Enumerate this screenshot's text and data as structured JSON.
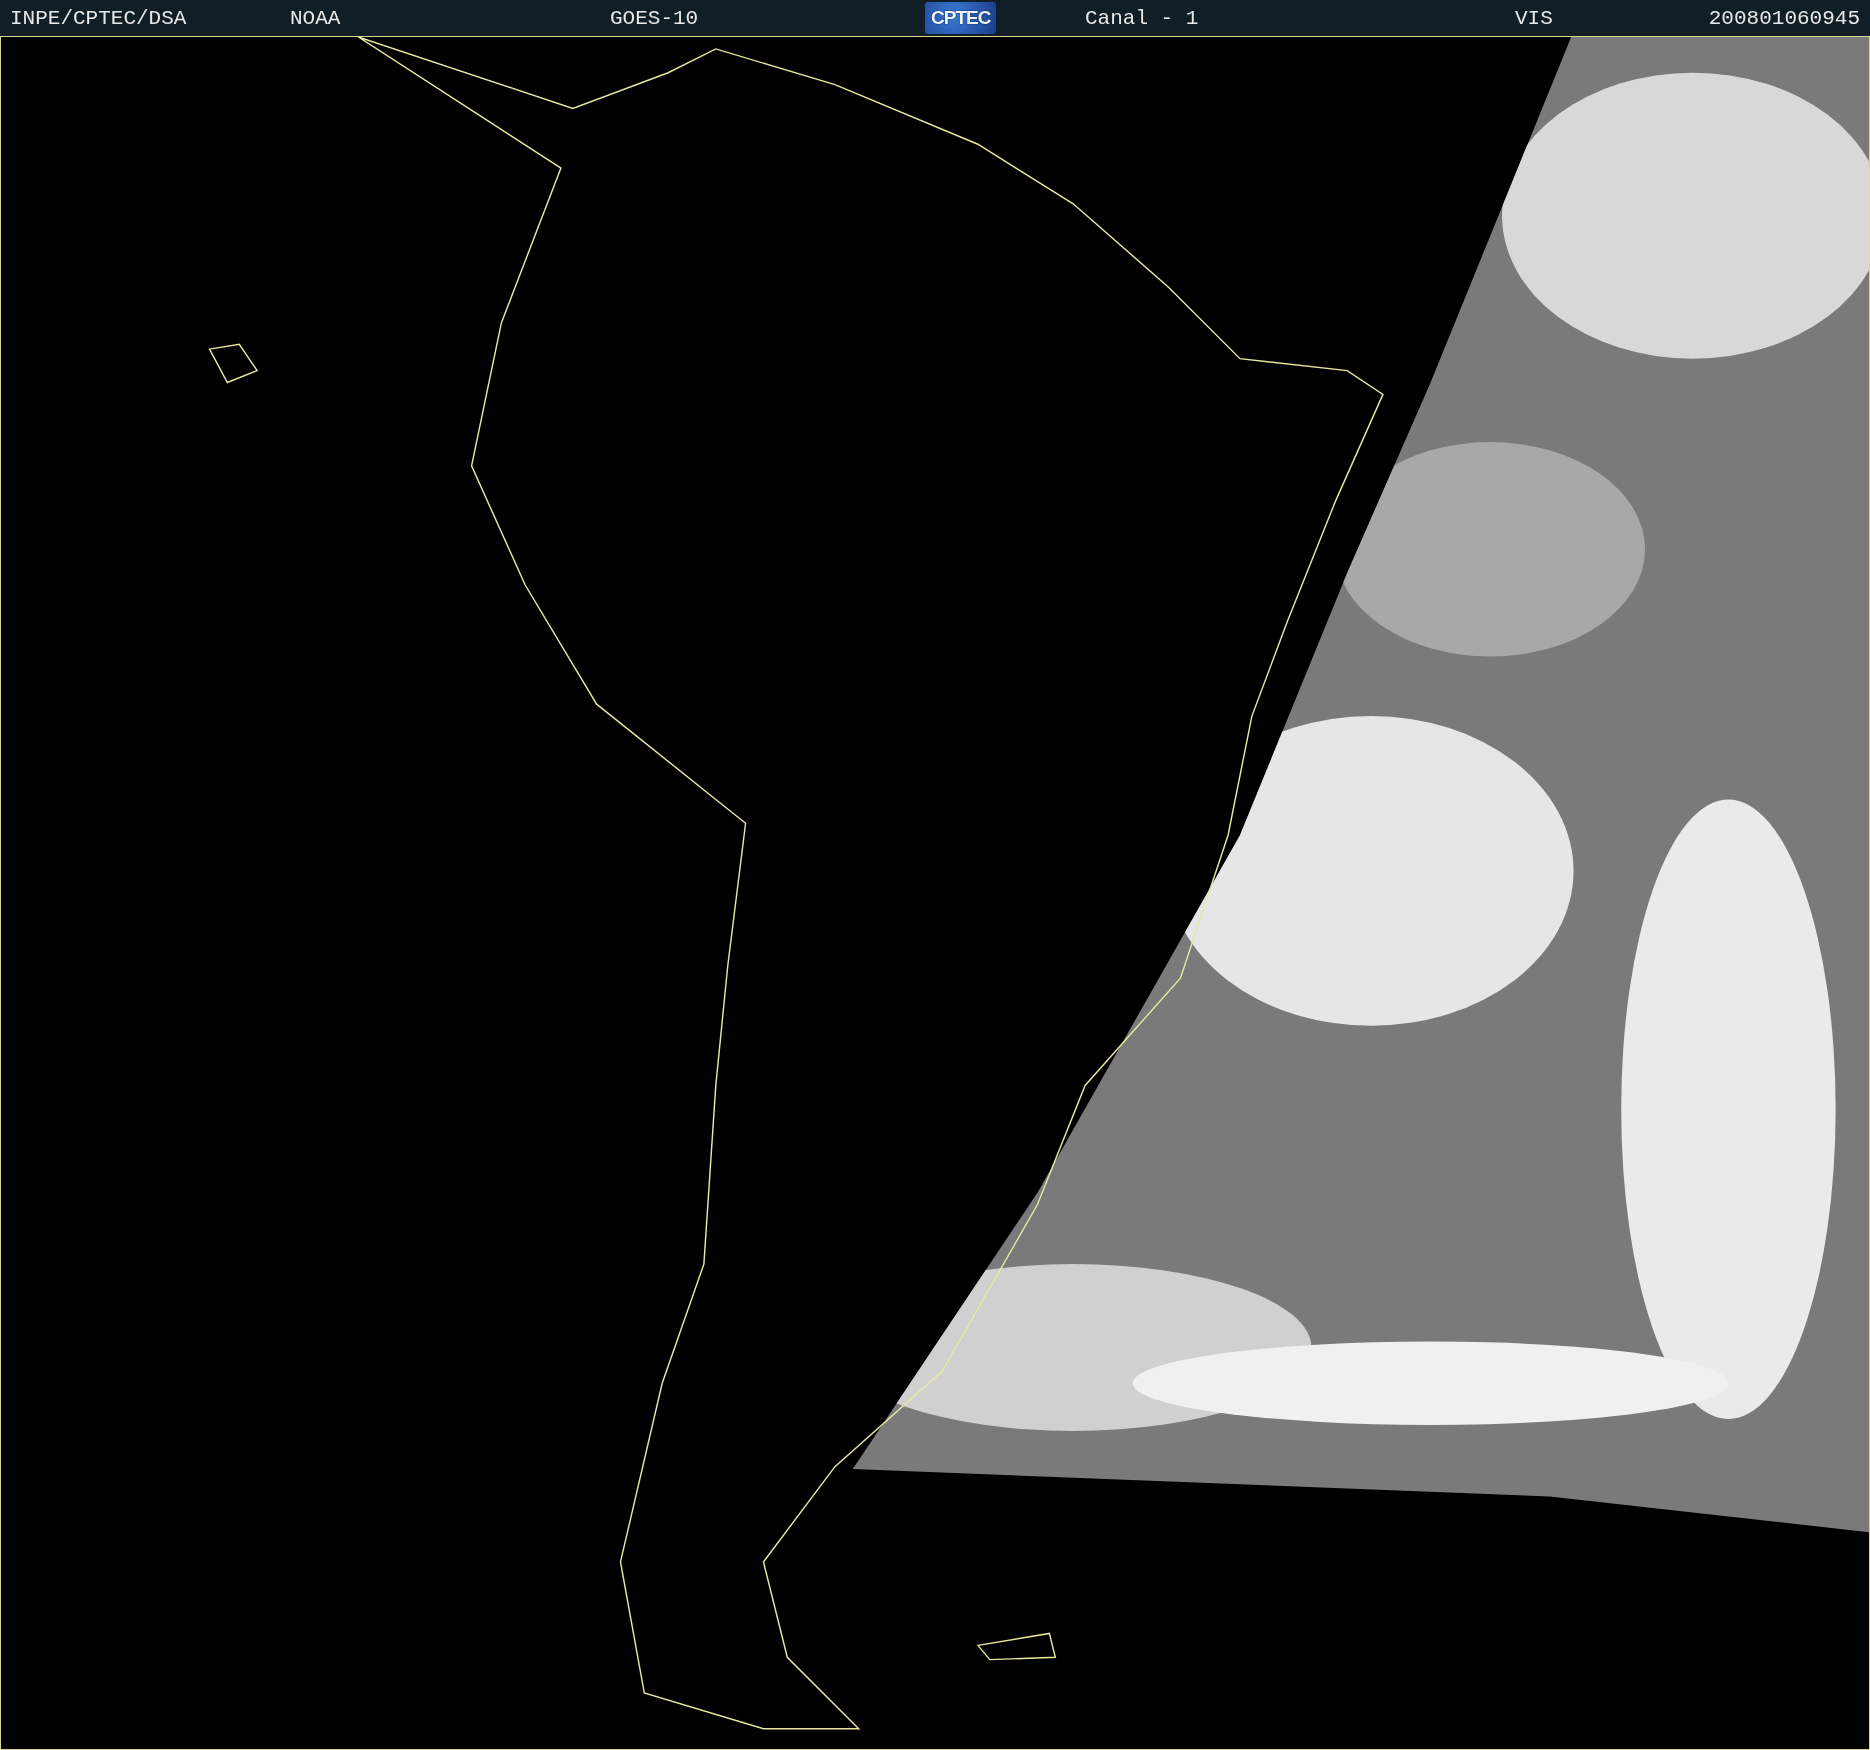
{
  "header": {
    "items": [
      {
        "text": "INPE/CPTEC/DSA",
        "kind": "text"
      },
      {
        "text": "NOAA",
        "kind": "text"
      },
      {
        "text": "GOES-10",
        "kind": "text"
      },
      {
        "text": "CPTEC",
        "kind": "logo"
      },
      {
        "text": "Canal - 1",
        "kind": "text"
      },
      {
        "text": "VIS",
        "kind": "text"
      },
      {
        "text": "200801060945",
        "kind": "text"
      }
    ]
  }
}
